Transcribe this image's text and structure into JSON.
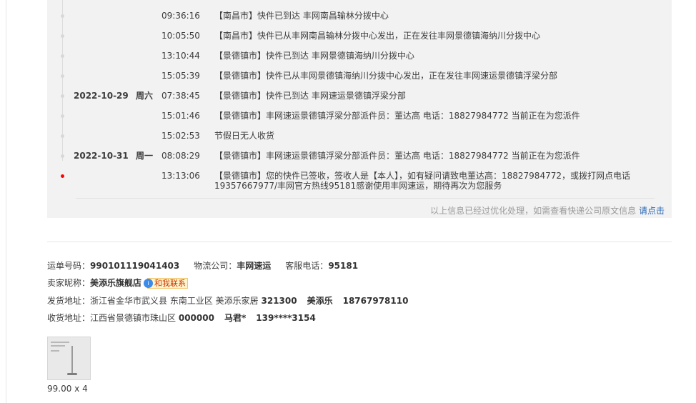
{
  "tracking": {
    "events": [
      {
        "date": "",
        "weekday": "",
        "time": "09:36:16",
        "desc": "【南昌市】快件已到达 丰网南昌输林分拨中心"
      },
      {
        "date": "",
        "weekday": "",
        "time": "10:05:50",
        "desc": "【南昌市】快件已从丰网南昌输林分拨中心发出，正在发往丰网景德镇海纳川分拨中心"
      },
      {
        "date": "",
        "weekday": "",
        "time": "13:10:44",
        "desc": "【景德镇市】快件已到达 丰网景德镇海纳川分拨中心"
      },
      {
        "date": "",
        "weekday": "",
        "time": "15:05:39",
        "desc": "【景德镇市】快件已从丰网景德镇海纳川分拨中心发出，正在发往丰网速运景德镇浮梁分部"
      },
      {
        "date": "2022-10-29",
        "weekday": "周六",
        "time": "07:38:45",
        "desc": "【景德镇市】快件已到达 丰网速运景德镇浮梁分部"
      },
      {
        "date": "",
        "weekday": "",
        "time": "15:01:46",
        "desc": "【景德镇市】丰网速运景德镇浮梁分部派件员：董达高 电话：18827984772 当前正在为您派件"
      },
      {
        "date": "",
        "weekday": "",
        "time": "15:02:53",
        "desc": "节假日无人收货"
      },
      {
        "date": "2022-10-31",
        "weekday": "周一",
        "time": "08:08:29",
        "desc": "【景德镇市】丰网速运景德镇浮梁分部派件员：董达高 电话：18827984772 当前正在为您派件"
      },
      {
        "date": "",
        "weekday": "",
        "time": "13:13:06",
        "desc": "【景德镇市】您的快件已签收，签收人是【本人】，如有疑问请致电董达高：18827984772，或拨打网点电话19357667977/丰网官方热线95181感谢使用丰网速运，期待再次为您服务"
      }
    ],
    "note": "以上信息已经过优化处理，如需查看快递公司原文信息",
    "note_link": "请点击"
  },
  "shipment": {
    "waybill_label": "运单号码：",
    "waybill_no": "990101119041403",
    "carrier_label": "物流公司：",
    "carrier": "丰网速运",
    "hotline_label": "客服电话：",
    "hotline": "95181"
  },
  "seller": {
    "nick_label": "卖家昵称：",
    "nick": "美添乐旗舰店",
    "contact_button": "和我联系",
    "contact_icon_glyph": "i"
  },
  "sender": {
    "label": "发货地址：",
    "address": "浙江省金华市武义县 东南工业区 美添乐家居",
    "zip": "321300",
    "name": "美添乐",
    "phone": "18767978110"
  },
  "receiver": {
    "label": "收货地址：",
    "address": "江西省景德镇市珠山区",
    "zip": "000000",
    "name": "马君*",
    "phone": "139****3154"
  },
  "item": {
    "price_qty": "99.00 x 4"
  },
  "colors": {
    "latest_dot": "#ff0000",
    "link": "#2b6ab5",
    "panel_bg": "#f2f2f2"
  }
}
